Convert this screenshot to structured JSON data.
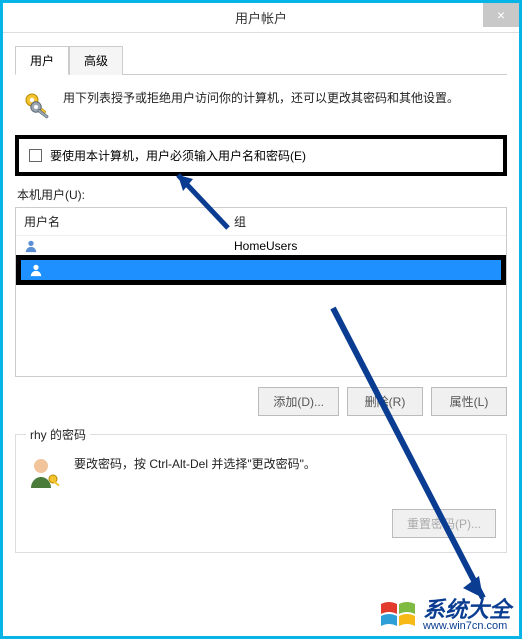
{
  "window": {
    "title": "用户帐户",
    "close_symbol": "×"
  },
  "tabs": {
    "users": "用户",
    "advanced": "高级"
  },
  "intro": {
    "text": "用下列表授予或拒绝用户访问你的计算机，还可以更改其密码和其他设置。"
  },
  "checkbox": {
    "label": "要使用本计算机，用户必须输入用户名和密码(E)"
  },
  "user_section": {
    "label": "本机用户(U):",
    "columns": {
      "username": "用户名",
      "group": "组"
    },
    "rows": [
      {
        "name": "",
        "group": "HomeUsers",
        "selected": false
      },
      {
        "name": "",
        "group": "",
        "selected": true
      }
    ]
  },
  "buttons": {
    "add": "添加(D)...",
    "remove": "删除(R)",
    "properties": "属性(L)"
  },
  "password_section": {
    "legend": "rhy 的密码",
    "text": "要改密码，按 Ctrl-Alt-Del 并选择\"更改密码\"。",
    "reset_button": "重置密码(P)..."
  },
  "watermark": {
    "main": "系统大全",
    "url": "www.win7cn.com"
  }
}
